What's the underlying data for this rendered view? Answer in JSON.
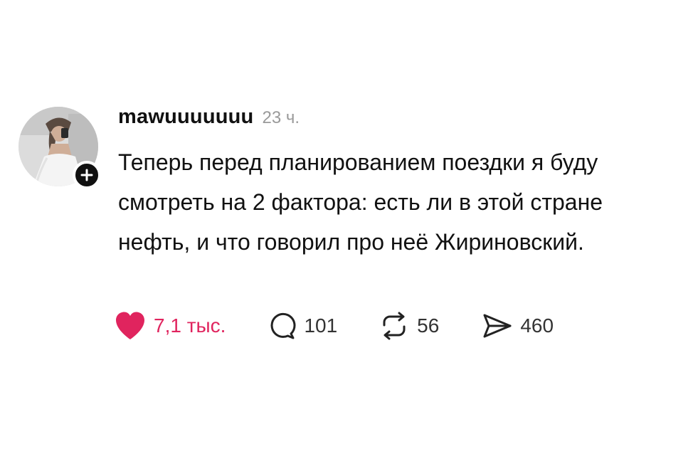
{
  "post": {
    "username": "mawuuuuuuu",
    "time": "23 ч.",
    "text": "Теперь перед планированием поездки я буду смотреть на 2 фактора: есть ли в этой стране нефть, и что говорил про неё Жириновский.",
    "actions": {
      "likes": "7,1 тыс.",
      "comments": "101",
      "reposts": "56",
      "shares": "460"
    },
    "liked": true
  },
  "colors": {
    "like": "#e0245e",
    "text": "#111111",
    "muted": "#9a9a9a",
    "badge": "#101010"
  },
  "icons": [
    "heart-icon",
    "comment-icon",
    "repost-icon",
    "share-icon",
    "plus-icon"
  ]
}
